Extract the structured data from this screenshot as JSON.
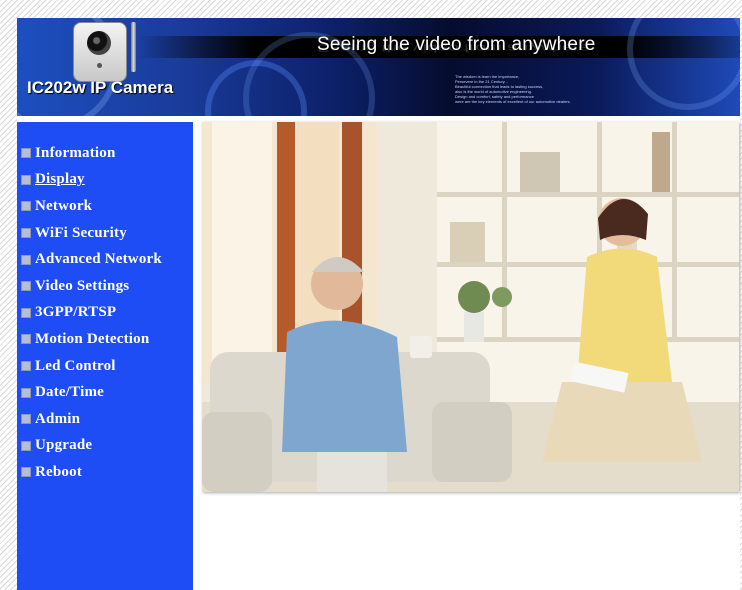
{
  "banner": {
    "brand": "IC202w IP Camera",
    "slogan": "Seeing the video from anywhere",
    "small_text": [
      "The wisdom is learn the importance,",
      "Persevere in the 21 Century...",
      "Beautiful connection that leads to lasting success,",
      "also is the world of automotive engineering.",
      "Design and comfort, safety and performance",
      "were are the key elements of excellent of our automotive dealers."
    ]
  },
  "sidebar": {
    "items": [
      {
        "label": "Information"
      },
      {
        "label": "Display"
      },
      {
        "label": "Network"
      },
      {
        "label": "WiFi Security"
      },
      {
        "label": "Advanced Network"
      },
      {
        "label": "Video Settings"
      },
      {
        "label": "3GPP/RTSP"
      },
      {
        "label": "Motion Detection"
      },
      {
        "label": "Led Control"
      },
      {
        "label": "Date/Time"
      },
      {
        "label": "Admin"
      },
      {
        "label": "Upgrade"
      },
      {
        "label": "Reboot"
      }
    ],
    "active_index": 1
  },
  "colors": {
    "sidebar": "#1e4cf5",
    "banner_dark": "#050c2e"
  }
}
